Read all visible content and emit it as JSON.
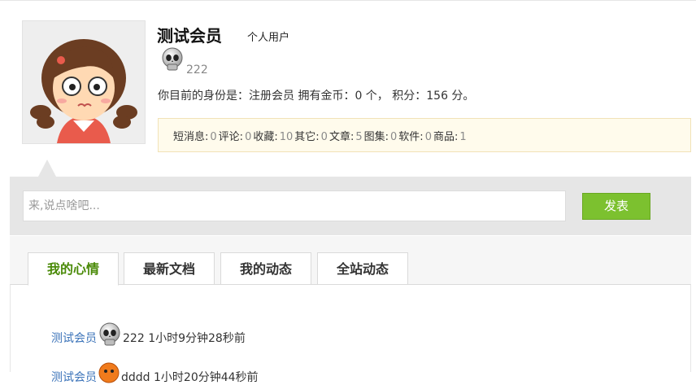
{
  "profile": {
    "name": "测试会员",
    "user_type": "个人用户",
    "status_text": "222",
    "identity_line": "你目前的身份是：注册会员 拥有金币：0 个， 积分：156 分。"
  },
  "stats": [
    {
      "label": "短消息:",
      "value": "0"
    },
    {
      "label": "评论:",
      "value": "0"
    },
    {
      "label": "收藏:",
      "value": "10"
    },
    {
      "label": "其它:",
      "value": "0"
    },
    {
      "label": "文章:",
      "value": "5"
    },
    {
      "label": "图集:",
      "value": "0"
    },
    {
      "label": "软件:",
      "value": "0"
    },
    {
      "label": "商品:",
      "value": "1"
    }
  ],
  "post": {
    "placeholder": "来,说点啥吧...",
    "button_label": "发表"
  },
  "tabs": [
    {
      "label": "我的心情",
      "active": true
    },
    {
      "label": "最新文档",
      "active": false
    },
    {
      "label": "我的动态",
      "active": false
    },
    {
      "label": "全站动态",
      "active": false
    }
  ],
  "feed": [
    {
      "user": "测试会员",
      "icon": "skull-icon",
      "text": "222",
      "time": "1小时9分钟28秒前"
    },
    {
      "user": "测试会员",
      "icon": "angry-face-icon",
      "text": "dddd",
      "time": "1小时20分钟44秒前"
    }
  ],
  "colors": {
    "accent_green": "#7cc12f",
    "active_tab_text": "#4a8a08",
    "link_blue": "#3b73b9",
    "stats_bg": "#fffbec"
  }
}
